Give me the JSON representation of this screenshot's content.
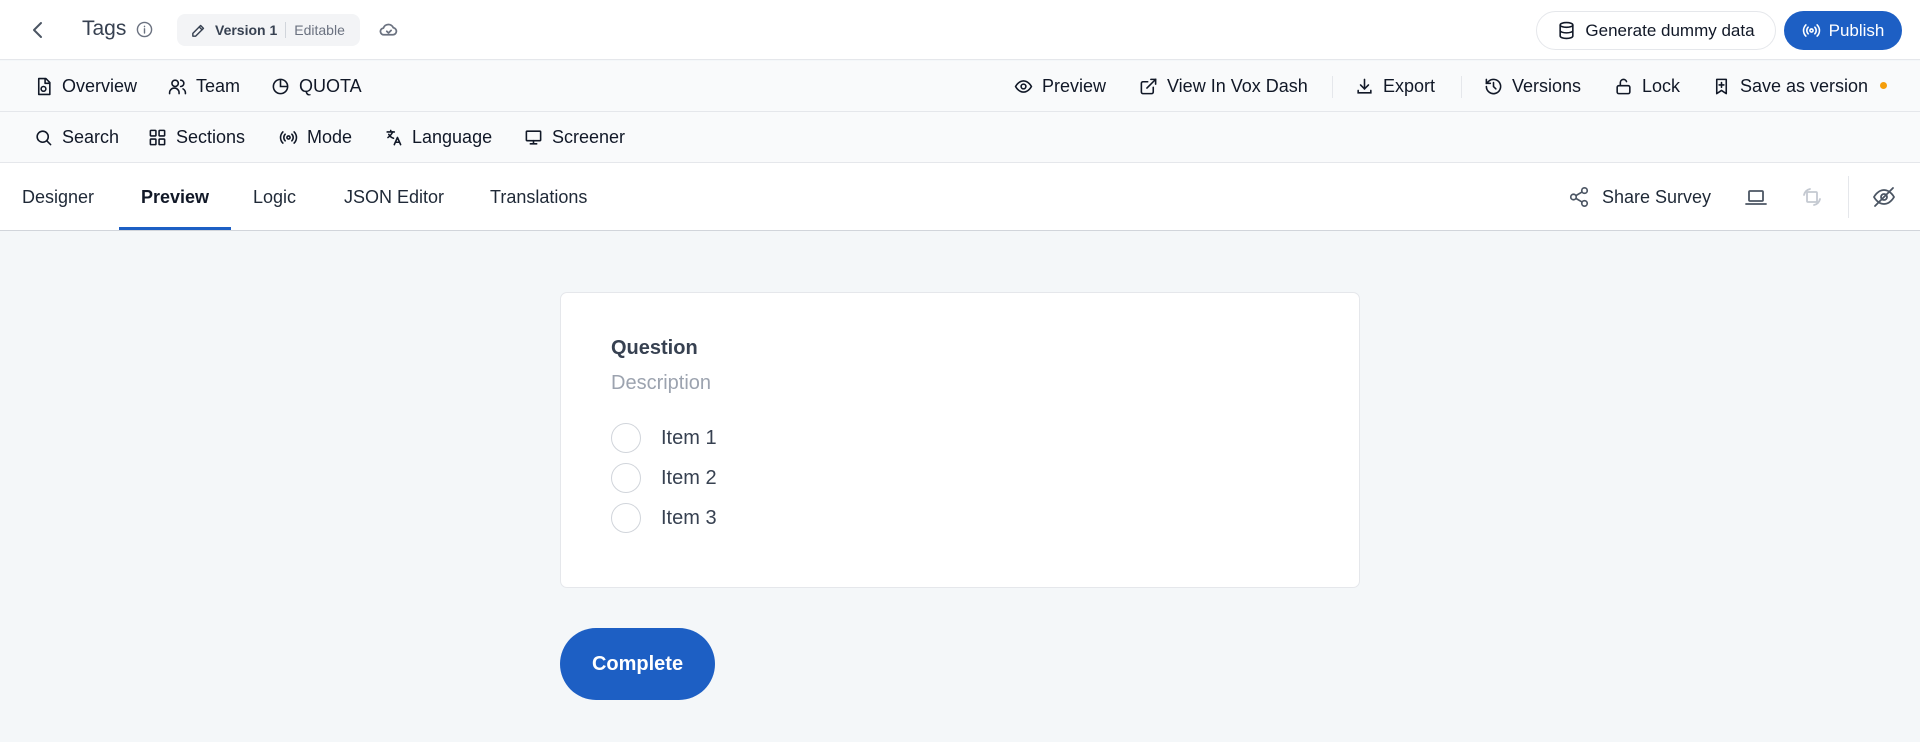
{
  "header": {
    "title": "Tags",
    "version_name": "Version 1",
    "version_state": "Editable",
    "generate_label": "Generate dummy data",
    "publish_label": "Publish"
  },
  "toolbar1": {
    "left": [
      {
        "label": "Overview",
        "icon": "file-report-icon"
      },
      {
        "label": "Team",
        "icon": "users-icon"
      },
      {
        "label": "QUOTA",
        "icon": "pie-chart-icon"
      }
    ],
    "right": [
      {
        "label": "Preview",
        "icon": "eye-icon"
      },
      {
        "label": "View In Vox Dash",
        "icon": "external-link-icon"
      },
      {
        "label": "Export",
        "icon": "download-icon"
      },
      {
        "label": "Versions",
        "icon": "history-icon"
      },
      {
        "label": "Lock",
        "icon": "unlock-icon"
      },
      {
        "label": "Save as version",
        "icon": "bookmark-plus-icon"
      }
    ]
  },
  "toolbar2": {
    "items": [
      {
        "label": "Search",
        "icon": "search-icon"
      },
      {
        "label": "Sections",
        "icon": "grid-icon"
      },
      {
        "label": "Mode",
        "icon": "broadcast-icon"
      },
      {
        "label": "Language",
        "icon": "translate-icon"
      },
      {
        "label": "Screener",
        "icon": "monitor-icon"
      }
    ]
  },
  "tabs": [
    {
      "label": "Designer",
      "active": false
    },
    {
      "label": "Preview",
      "active": true
    },
    {
      "label": "Logic",
      "active": false
    },
    {
      "label": "JSON Editor",
      "active": false
    },
    {
      "label": "Translations",
      "active": false
    }
  ],
  "tab_actions": {
    "share_label": "Share Survey"
  },
  "question": {
    "title": "Question",
    "description": "Description",
    "options": [
      "Item 1",
      "Item 2",
      "Item 3"
    ]
  },
  "complete_label": "Complete",
  "colors": {
    "primary": "#1d5fc4",
    "unsaved_dot": "#f59e0b",
    "canvas": "#f4f7f9"
  }
}
